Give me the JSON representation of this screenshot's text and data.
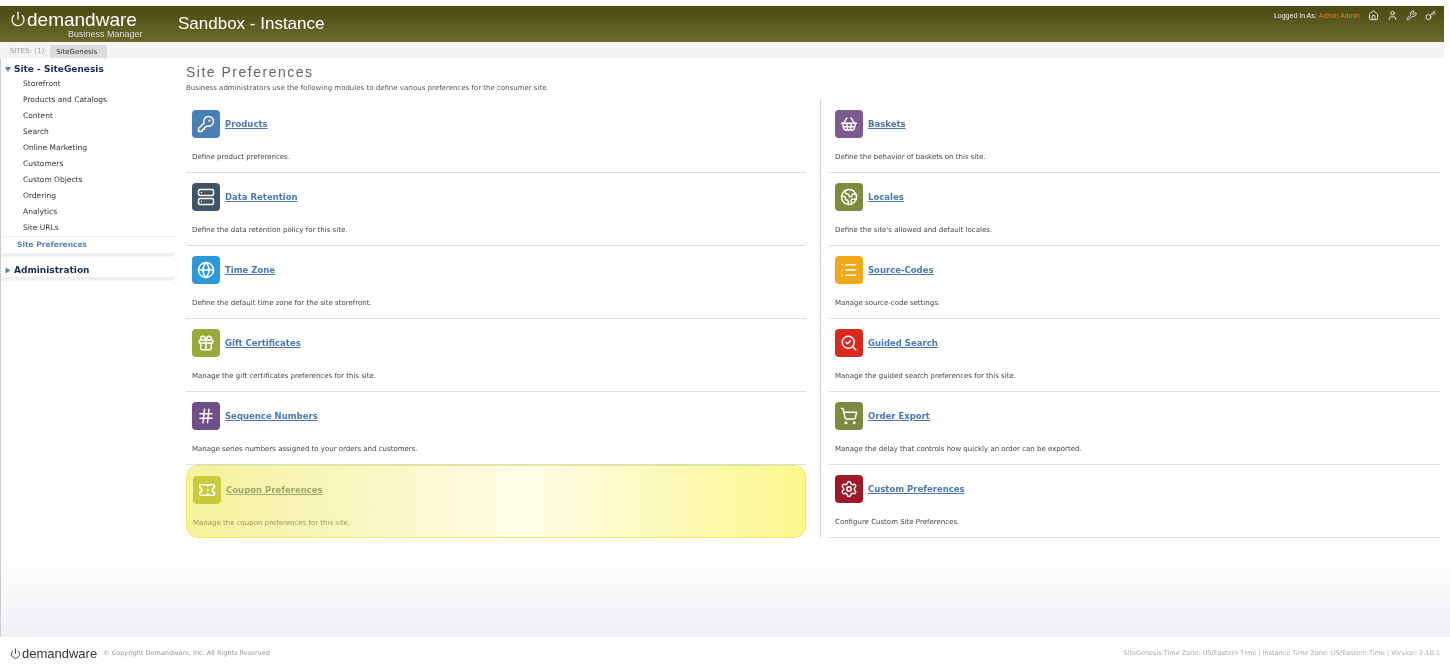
{
  "header": {
    "logo": "demandware",
    "logo_sub": "Business Manager",
    "title": "Sandbox - Instance",
    "logged_in_label": "Logged In As:",
    "user": "Admin Admin"
  },
  "sites_bar": {
    "label": "SITES: (1)",
    "tabs": [
      {
        "label": "SiteGenesis",
        "selected": true
      }
    ]
  },
  "sidebar": {
    "groups": [
      {
        "label": "Site - SiteGenesis",
        "expanded": true,
        "children": [
          {
            "label": "Storefront",
            "selected": false
          },
          {
            "label": "Products and Catalogs",
            "selected": false
          },
          {
            "label": "Content",
            "selected": false
          },
          {
            "label": "Search",
            "selected": false
          },
          {
            "label": "Online Marketing",
            "selected": false
          },
          {
            "label": "Customers",
            "selected": false
          },
          {
            "label": "Custom Objects",
            "selected": false
          },
          {
            "label": "Ordering",
            "selected": false
          },
          {
            "label": "Analytics",
            "selected": false
          },
          {
            "label": "Site URLs",
            "selected": false
          },
          {
            "label": "Site Preferences",
            "selected": true
          }
        ]
      },
      {
        "label": "Administration",
        "expanded": false
      }
    ]
  },
  "page": {
    "title": "Site Preferences",
    "description": "Business administrators use the following modules to define various preferences for the consumer site.",
    "columns": [
      [
        {
          "title": "Products",
          "description": "Define product preferences.",
          "color": "#4a7fb5",
          "highlighted": false
        },
        {
          "title": "Data Retention",
          "description": "Define the data retention policy for this site.",
          "color": "#3f5566",
          "highlighted": false
        },
        {
          "title": "Time Zone",
          "description": "Define the default time zone for the site storefront.",
          "color": "#2a9bd6",
          "highlighted": false
        },
        {
          "title": "Gift Certificates",
          "description": "Manage the gift certificates preferences for this site.",
          "color": "#9aaa3a",
          "highlighted": false
        },
        {
          "title": "Sequence Numbers",
          "description": "Manage series numbers assigned to your orders and customers.",
          "color": "#6e4f8a",
          "highlighted": false
        },
        {
          "title": "Coupon Preferences",
          "description": "Manage the coupon preferences for this site.",
          "color": "#c8cc3c",
          "highlighted": true
        }
      ],
      [
        {
          "title": "Baskets",
          "description": "Define the behavior of baskets on this site.",
          "color": "#7a5a8f",
          "highlighted": false
        },
        {
          "title": "Locales",
          "description": "Define the site's allowed and default locales.",
          "color": "#7f8a3c",
          "highlighted": false
        },
        {
          "title": "Source-Codes",
          "description": "Manage source-code settings.",
          "color": "#f0a818",
          "highlighted": false
        },
        {
          "title": "Guided Search",
          "description": "Manage the guided search preferences for this site.",
          "color": "#d9281e",
          "highlighted": false
        },
        {
          "title": "Order Export",
          "description": "Manage the delay that controls how quickly an order can be exported.",
          "color": "#7d8a3f",
          "highlighted": false
        },
        {
          "title": "Custom Preferences",
          "description": "Configure Custom Site Preferences.",
          "color": "#a01828",
          "highlighted": false
        }
      ]
    ]
  },
  "footer": {
    "logo": "demandware",
    "copyright": "© Copyright Demandware, Inc. All Rights Reserved",
    "info": "SiteGenesis Time Zone: US/Eastern Time | Instance Time Zone: US/Eastern Time | Version: 2.10.1"
  }
}
